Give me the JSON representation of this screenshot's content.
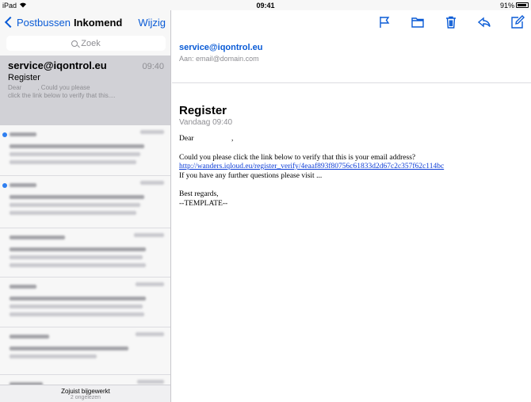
{
  "status_bar": {
    "device": "iPad",
    "time": "09:41",
    "battery": "91%"
  },
  "sidebar": {
    "back_label": "Postbussen",
    "title": "Inkomend",
    "edit_label": "Wijzig",
    "search_placeholder": "Zoek",
    "selected_message": {
      "from": "service@iqontrol.eu",
      "time": "09:40",
      "subject": "Register",
      "preview_line1": "Dear         , Could you please",
      "preview_line2": "click the link below to verify that this...."
    },
    "footer": {
      "updated": "Zojuist bijgewerkt",
      "unread": "2 ongelezen"
    }
  },
  "message": {
    "sender": "service@iqontrol.eu",
    "to": "Aan: email@domain.com",
    "subject": "Register",
    "date": "Vandaag 09:40",
    "greeting": "Dear                    ,",
    "line1": "Could you please click the link below to verify that this is your email address?",
    "link": "http://wanders.iqloud.eu/register_verify/4eaaf893f80756c61833d2d67c2c357f62c114bc",
    "line2": "If you have any further questions please visit ...",
    "signoff": "Best regards,",
    "signature": "--TEMPLATE--"
  },
  "colors": {
    "accent": "#0a5bd6",
    "unread_dot": "#2f7ff0",
    "selected_bg": "#d1d1d6"
  }
}
